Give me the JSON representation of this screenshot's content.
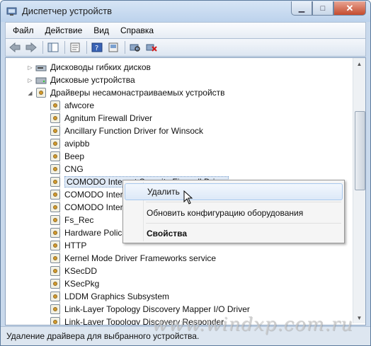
{
  "window": {
    "title": "Диспетчер устройств",
    "controls": {
      "minimize": "▁",
      "maximize": "□",
      "close": "✕"
    }
  },
  "menu": [
    "Файл",
    "Действие",
    "Вид",
    "Справка"
  ],
  "tree": {
    "categories": [
      {
        "label": "Дисководы гибких дисков",
        "state": "collapsed"
      },
      {
        "label": "Дисковые устройства",
        "state": "collapsed"
      },
      {
        "label": "Драйверы несамонастраиваемых устройств",
        "state": "expanded"
      }
    ],
    "items": [
      "afwcore",
      "Agnitum Firewall Driver",
      "Ancillary Function Driver for Winsock",
      "avipbb",
      "Beep",
      "CNG",
      "COMODO Internet Security Firewall Driver",
      "COMODO Inter",
      "COMODO Inter",
      "Fs_Rec",
      "Hardware Polic",
      "HTTP",
      "Kernel Mode Driver Frameworks service",
      "KSecDD",
      "KSecPkg",
      "LDDM Graphics Subsystem",
      "Link-Layer Topology Discovery Mapper I/O Driver",
      "Link-Layer Topology Discovery Responder"
    ],
    "selected_index": 6
  },
  "context_menu": {
    "delete": "Удалить",
    "update": "Обновить конфигурацию оборудования",
    "properties": "Свойства"
  },
  "status": "Удаление драйвера для выбранного устройства.",
  "watermark": "www.windxp.com.ru"
}
